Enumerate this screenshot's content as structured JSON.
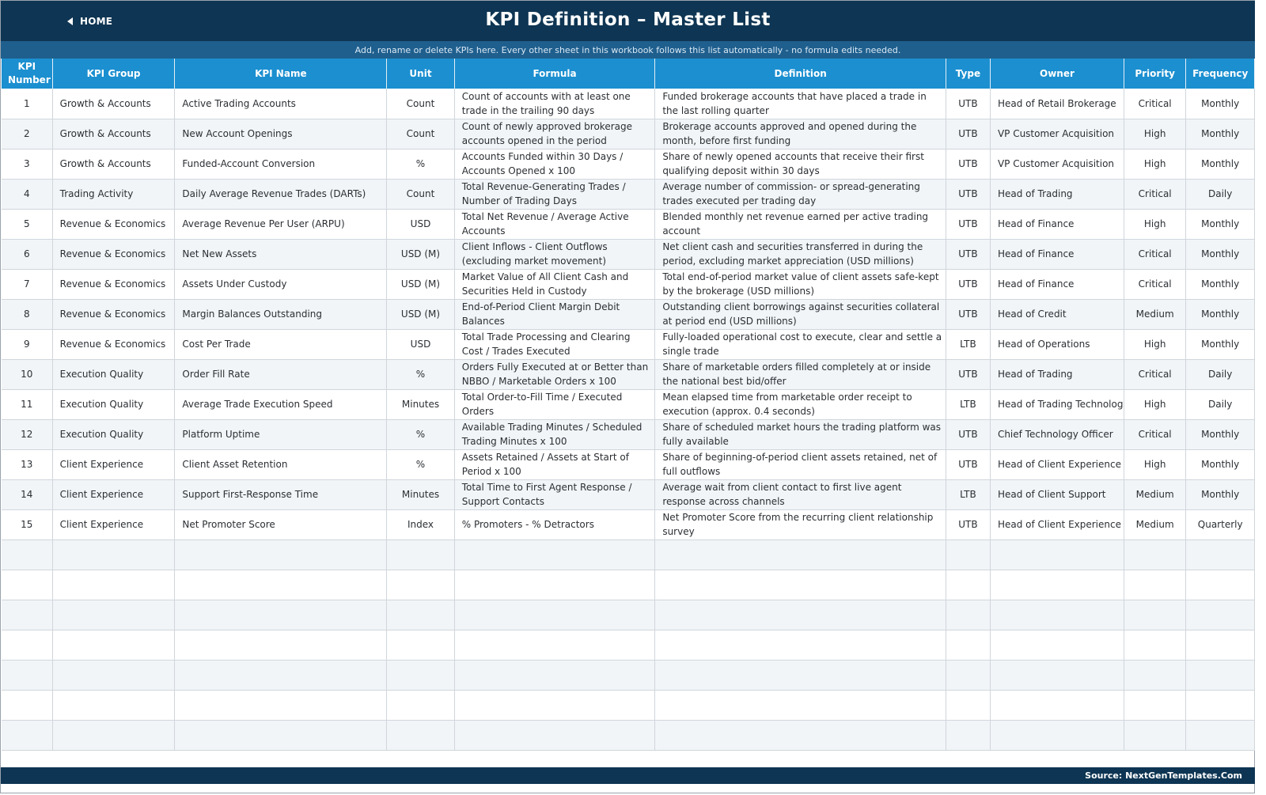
{
  "header": {
    "home_label": "HOME",
    "title": "KPI Definition  –  Master List",
    "subtitle": "Add, rename or delete KPIs here. Every other sheet in this workbook follows this list automatically - no formula edits needed."
  },
  "table": {
    "columns": [
      "KPI Number",
      "KPI Group",
      "KPI Name",
      "Unit",
      "Formula",
      "Definition",
      "Type",
      "Owner",
      "Priority",
      "Frequency"
    ],
    "rows": [
      [
        "1",
        "Growth & Accounts",
        "Active Trading Accounts",
        "Count",
        "Count of accounts with at least one trade in the trailing 90 days",
        "Funded brokerage accounts that have placed a trade in the last rolling quarter",
        "UTB",
        "Head of Retail Brokerage",
        "Critical",
        "Monthly"
      ],
      [
        "2",
        "Growth & Accounts",
        "New Account Openings",
        "Count",
        "Count of newly approved brokerage accounts opened in the period",
        "Brokerage accounts approved and opened during the month, before first funding",
        "UTB",
        "VP Customer Acquisition",
        "High",
        "Monthly"
      ],
      [
        "3",
        "Growth & Accounts",
        "Funded-Account Conversion",
        "%",
        "Accounts Funded within 30 Days / Accounts Opened x 100",
        "Share of newly opened accounts that receive their first qualifying deposit within 30 days",
        "UTB",
        "VP Customer Acquisition",
        "High",
        "Monthly"
      ],
      [
        "4",
        "Trading Activity",
        "Daily Average Revenue Trades (DARTs)",
        "Count",
        "Total Revenue-Generating Trades / Number of Trading Days",
        "Average number of commission- or spread-generating trades executed per trading day",
        "UTB",
        "Head of Trading",
        "Critical",
        "Daily"
      ],
      [
        "5",
        "Revenue & Economics",
        "Average Revenue Per User (ARPU)",
        "USD",
        "Total Net Revenue / Average Active Accounts",
        "Blended monthly net revenue earned per active trading account",
        "UTB",
        "Head of Finance",
        "High",
        "Monthly"
      ],
      [
        "6",
        "Revenue & Economics",
        "Net New Assets",
        "USD (M)",
        "Client Inflows - Client Outflows (excluding market movement)",
        "Net client cash and securities transferred in during the period, excluding market appreciation (USD millions)",
        "UTB",
        "Head of Finance",
        "Critical",
        "Monthly"
      ],
      [
        "7",
        "Revenue & Economics",
        "Assets Under Custody",
        "USD (M)",
        "Market Value of All Client Cash and Securities Held in Custody",
        "Total end-of-period market value of client assets safe-kept by the brokerage (USD millions)",
        "UTB",
        "Head of Finance",
        "Critical",
        "Monthly"
      ],
      [
        "8",
        "Revenue & Economics",
        "Margin Balances Outstanding",
        "USD (M)",
        "End-of-Period Client Margin Debit Balances",
        "Outstanding client borrowings against securities collateral at period end (USD millions)",
        "UTB",
        "Head of Credit",
        "Medium",
        "Monthly"
      ],
      [
        "9",
        "Revenue & Economics",
        "Cost Per Trade",
        "USD",
        "Total Trade Processing and Clearing Cost / Trades Executed",
        "Fully-loaded operational cost to execute, clear and settle a single trade",
        "LTB",
        "Head of Operations",
        "High",
        "Monthly"
      ],
      [
        "10",
        "Execution Quality",
        "Order Fill Rate",
        "%",
        "Orders Fully Executed at or Better than NBBO / Marketable Orders x 100",
        "Share of marketable orders filled completely at or inside the national best bid/offer",
        "UTB",
        "Head of Trading",
        "Critical",
        "Daily"
      ],
      [
        "11",
        "Execution Quality",
        "Average Trade Execution Speed",
        "Minutes",
        "Total Order-to-Fill Time / Executed Orders",
        "Mean elapsed time from marketable order receipt to execution (approx. 0.4 seconds)",
        "LTB",
        "Head of Trading Technology",
        "High",
        "Daily"
      ],
      [
        "12",
        "Execution Quality",
        "Platform Uptime",
        "%",
        "Available Trading Minutes / Scheduled Trading Minutes x 100",
        "Share of scheduled market hours the trading platform was fully available",
        "UTB",
        "Chief Technology Officer",
        "Critical",
        "Monthly"
      ],
      [
        "13",
        "Client Experience",
        "Client Asset Retention",
        "%",
        "Assets Retained / Assets at Start of Period x 100",
        "Share of beginning-of-period client assets retained, net of full outflows",
        "UTB",
        "Head of Client Experience",
        "High",
        "Monthly"
      ],
      [
        "14",
        "Client Experience",
        "Support First-Response Time",
        "Minutes",
        "Total Time to First Agent Response / Support Contacts",
        "Average wait from client contact to first live agent response across channels",
        "LTB",
        "Head of Client Support",
        "Medium",
        "Monthly"
      ],
      [
        "15",
        "Client Experience",
        "Net Promoter Score",
        "Index",
        "% Promoters - % Detractors",
        "Net Promoter Score from the recurring client relationship survey",
        "UTB",
        "Head of Client Experience",
        "Medium",
        "Quarterly"
      ]
    ],
    "empty_rows": 7
  },
  "footer": {
    "source": "Source: NextGenTemplates.Com"
  },
  "colors": {
    "title_bar": "#0e3553",
    "sub_bar": "#1f5f8e",
    "table_header": "#1b8fd0",
    "row_alt": "#f1f5f8"
  }
}
